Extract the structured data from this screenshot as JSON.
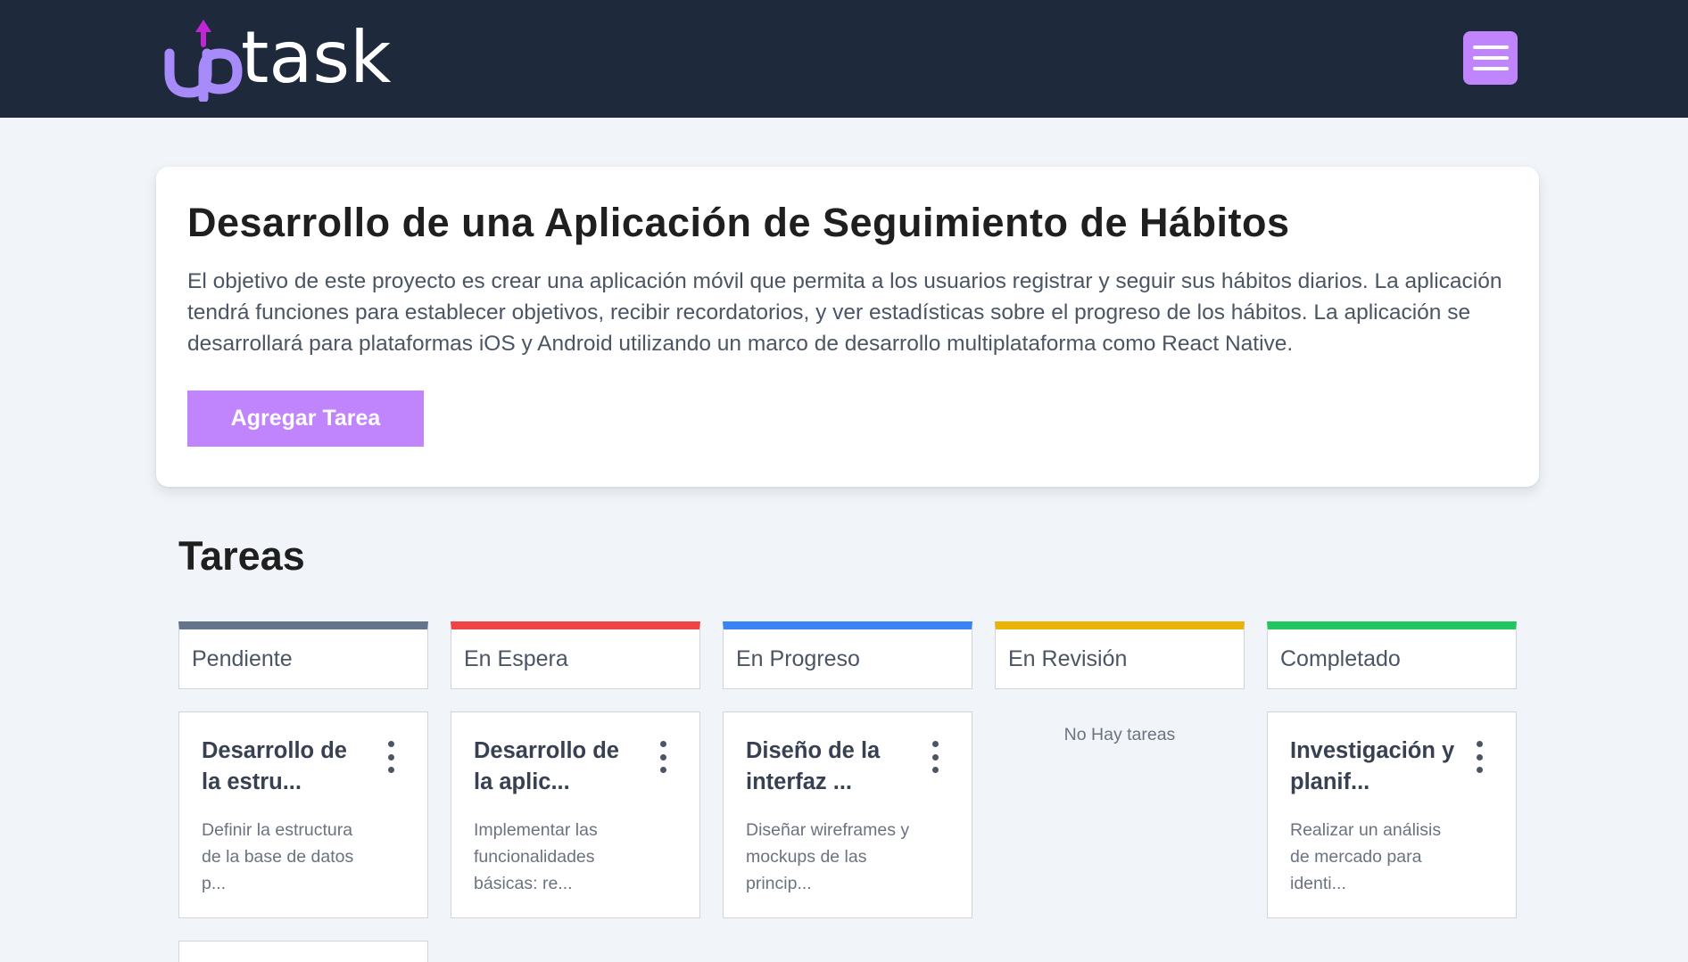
{
  "header": {
    "logo_text": "uptask",
    "menu_icon": "hamburger-menu-icon",
    "colors": {
      "bar": "#1e293b",
      "accent": "#c084fc"
    }
  },
  "project": {
    "title": "Desarrollo de una Aplicación de Seguimiento de Hábitos",
    "description": "El objetivo de este proyecto es crear una aplicación móvil que permita a los usuarios registrar y seguir sus hábitos diarios. La aplicación tendrá funciones para establecer objetivos, recibir recordatorios, y ver estadísticas sobre el progreso de los hábitos. La aplicación se desarrollará para plataformas iOS y Android utilizando un marco de desarrollo multiplataforma como React Native.",
    "add_task_label": "Agregar Tarea"
  },
  "tasks": {
    "heading": "Tareas",
    "empty_label": "No Hay tareas",
    "columns": [
      {
        "label": "Pendiente",
        "color": "#64748b"
      },
      {
        "label": "En Espera",
        "color": "#ef4444"
      },
      {
        "label": "En Progreso",
        "color": "#3b82f6"
      },
      {
        "label": "En Revisión",
        "color": "#eab308"
      },
      {
        "label": "Completado",
        "color": "#22c55e"
      }
    ],
    "cards": {
      "pendiente": {
        "title": "Desarrollo de la estru...",
        "description": "Definir la estructura de la base de datos p..."
      },
      "en_espera": {
        "title": "Desarrollo de la aplic...",
        "description": "Implementar las funcionalidades básicas: re..."
      },
      "en_progreso": {
        "title": "Diseño de la interfaz ...",
        "description": "Diseñar wireframes y mockups de las princip..."
      },
      "completado": {
        "title": "Investigación y planif...",
        "description": "Realizar un análisis de mercado para identi..."
      }
    }
  }
}
